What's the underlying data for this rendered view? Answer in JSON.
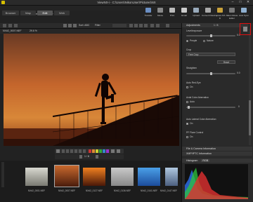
{
  "window": {
    "title": "ViewNX-i - C:\\Users\\NikonUser\\Pictures\\NX",
    "min": "–",
    "max": "□",
    "close": "✕"
  },
  "menu": [
    "File",
    "Edit",
    "Image",
    "View",
    "Window",
    "Help"
  ],
  "tabs": [
    {
      "label": "Browser"
    },
    {
      "label": "Map"
    },
    {
      "label": "Edit"
    },
    {
      "label": "Web"
    }
  ],
  "toolbar": [
    {
      "label": "Transfer",
      "icon": "transfer-icon"
    },
    {
      "label": "Movie",
      "icon": "movie-icon"
    },
    {
      "label": "Print",
      "icon": "print-icon"
    },
    {
      "label": "Email",
      "icon": "email-icon"
    },
    {
      "label": "Upload",
      "icon": "upload-icon"
    },
    {
      "label": "Convert Files",
      "icon": "convert-icon"
    },
    {
      "label": "Capture NX-D",
      "icon": "capture-icon"
    },
    {
      "label": "Nikon Movie Editor",
      "icon": "movie-editor-icon"
    },
    {
      "label": "Auto Sync",
      "icon": "sync-icon"
    }
  ],
  "subtoolbar": {
    "sort": "Sort: ABC",
    "filter": "Filter",
    "page": "1 / 8"
  },
  "image_info": {
    "name": "NX#2_0007.NEF",
    "zoom": "29.6 %"
  },
  "viewer": {
    "pager": "1 / 8"
  },
  "filmstrip": [
    {
      "label": "NX#2_0001.NEF"
    },
    {
      "label": "NX#2_0007.NEF"
    },
    {
      "label": "NX#2_0127.NEF"
    },
    {
      "label": "NX#2_0136.NEF"
    },
    {
      "label": "NX#2_0141.NEF"
    },
    {
      "label": "NX#2_0147.NEF"
    }
  ],
  "panel": {
    "adjustments": "Adjustments",
    "page": "1 / 8",
    "exposure_label": "Level/exposure",
    "exposure_value": "0.0",
    "radio1": "People",
    "radio2": "Nature",
    "crop_label": "Crop",
    "crop_value": "Free Crop",
    "reset": "Reset",
    "straighten": "Straighten",
    "straighten_value": "0.0",
    "auto_red": "Auto Red-Eye",
    "auto_red_on": "On",
    "axial": "Axial Color Aberration",
    "axial_auto": "Auto",
    "axial_val": "0",
    "auto_lateral": "Auto Lateral Color Aberration",
    "lateral_on": "On",
    "pf": "PF Flare Control",
    "pf_on": "On",
    "file_info": "File & Camera Information",
    "xmp": "XMP/IPTC Information",
    "histogram": "Histogram",
    "hist_mode": "RGB"
  }
}
